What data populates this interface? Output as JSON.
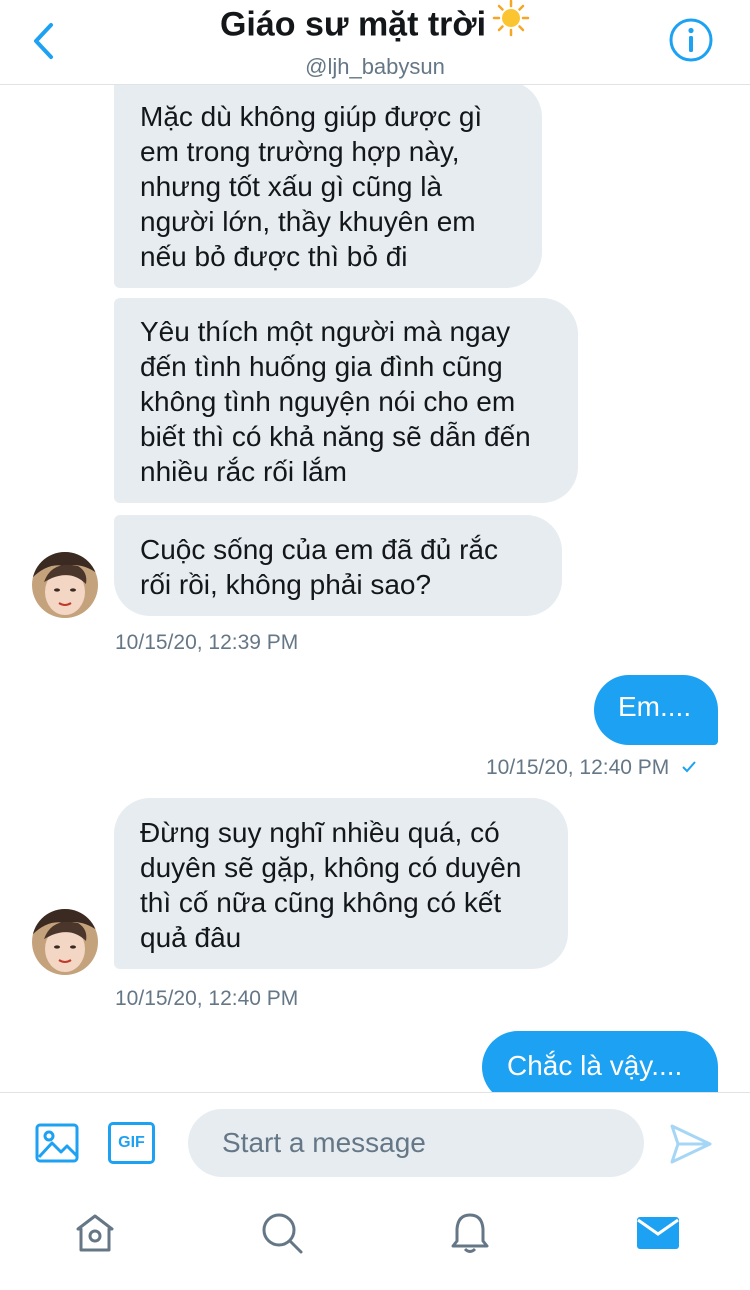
{
  "header": {
    "title": "Giáo sư mặt trời",
    "title_emoji": "sun-icon",
    "handle": "@ljh_babysun"
  },
  "messages": [
    {
      "direction": "received",
      "text": "Mặc dù không giúp được gì em trong trường hợp này, nhưng tốt xấu gì cũng là người lớn, thầy khuyên em nếu bỏ được thì bỏ đi"
    },
    {
      "direction": "received",
      "text": "Yêu thích một người mà ngay đến tình huống gia đình cũng không tình nguyện nói cho em biết thì có khả năng sẽ dẫn đến nhiều rắc rối lắm"
    },
    {
      "direction": "received",
      "text": "Cuộc sống của em đã đủ rắc rối rồi, không phải sao?"
    },
    {
      "direction": "sent",
      "text": "Em...."
    },
    {
      "direction": "received",
      "text": "Đừng suy nghĩ nhiều quá, có duyên sẽ gặp, không có duyên thì cố nữa cũng không có kết quả đâu"
    },
    {
      "direction": "sent",
      "text": "Chắc là vậy...."
    }
  ],
  "timestamps": {
    "t1": "10/15/20, 12:39 PM",
    "t2": "10/15/20, 12:40 PM",
    "t3": "10/15/20, 12:40 PM"
  },
  "composer": {
    "placeholder": "Start a message",
    "gif_label": "GIF"
  },
  "tabs": [
    "home-icon",
    "search-icon",
    "notifications-icon",
    "messages-icon"
  ],
  "colors": {
    "accent": "#1da1f2",
    "received_bubble": "#e6ecf0",
    "secondary_text": "#657786"
  }
}
